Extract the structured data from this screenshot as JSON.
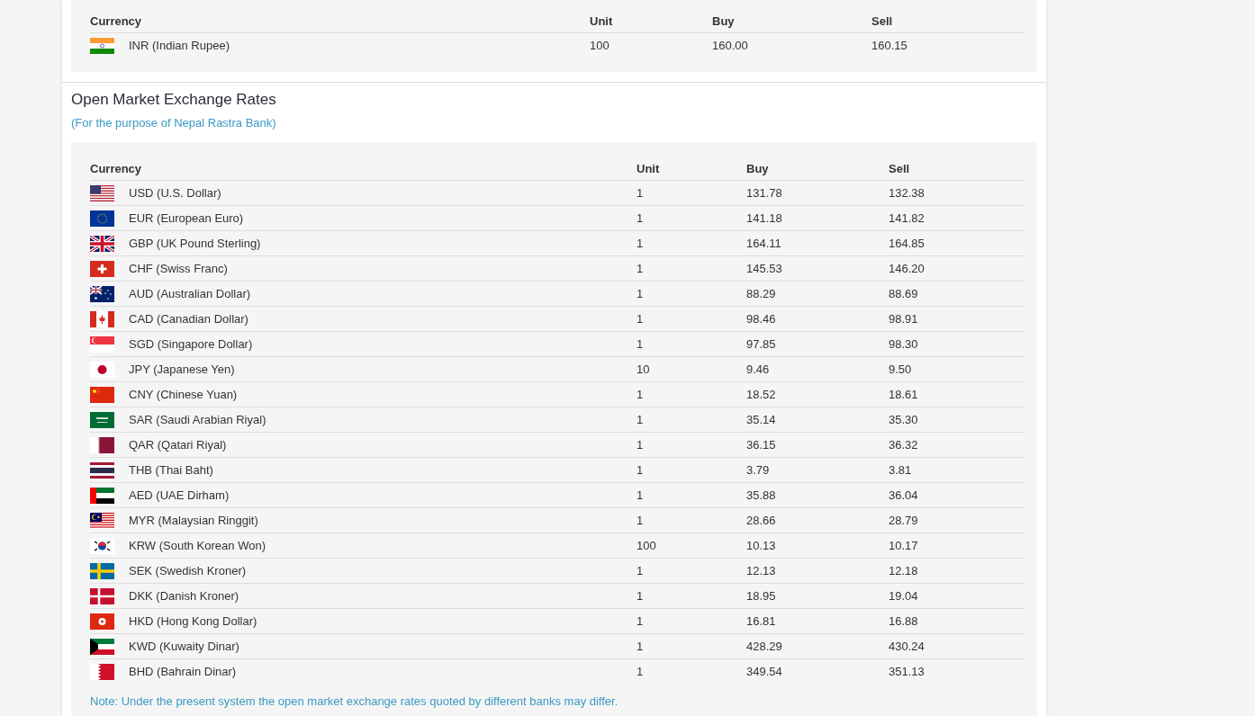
{
  "official_rates": {
    "columns": [
      "Currency",
      "Unit",
      "Buy",
      "Sell"
    ],
    "rows": [
      {
        "kind": "in",
        "currency": "INR (Indian Rupee)",
        "unit": "100",
        "buy": "160.00",
        "sell": "160.15"
      }
    ]
  },
  "open_market": {
    "title": "Open Market Exchange Rates",
    "subtitle": "(For the purpose of Nepal Rastra Bank)",
    "columns": [
      "Currency",
      "Unit",
      "Buy",
      "Sell"
    ],
    "rows": [
      {
        "kind": "us",
        "currency": "USD (U.S. Dollar)",
        "unit": "1",
        "buy": "131.78",
        "sell": "132.38"
      },
      {
        "kind": "eu",
        "currency": "EUR (European Euro)",
        "unit": "1",
        "buy": "141.18",
        "sell": "141.82"
      },
      {
        "kind": "gb",
        "currency": "GBP (UK Pound Sterling)",
        "unit": "1",
        "buy": "164.11",
        "sell": "164.85"
      },
      {
        "kind": "ch",
        "currency": "CHF (Swiss Franc)",
        "unit": "1",
        "buy": "145.53",
        "sell": "146.20"
      },
      {
        "kind": "au",
        "currency": "AUD (Australian Dollar)",
        "unit": "1",
        "buy": "88.29",
        "sell": "88.69"
      },
      {
        "kind": "ca",
        "currency": "CAD (Canadian Dollar)",
        "unit": "1",
        "buy": "98.46",
        "sell": "98.91"
      },
      {
        "kind": "sg",
        "currency": "SGD (Singapore Dollar)",
        "unit": "1",
        "buy": "97.85",
        "sell": "98.30"
      },
      {
        "kind": "jp",
        "currency": "JPY (Japanese Yen)",
        "unit": "10",
        "buy": "9.46",
        "sell": "9.50"
      },
      {
        "kind": "cn",
        "currency": "CNY (Chinese Yuan)",
        "unit": "1",
        "buy": "18.52",
        "sell": "18.61"
      },
      {
        "kind": "sa",
        "currency": "SAR (Saudi Arabian Riyal)",
        "unit": "1",
        "buy": "35.14",
        "sell": "35.30"
      },
      {
        "kind": "qa",
        "currency": "QAR (Qatari Riyal)",
        "unit": "1",
        "buy": "36.15",
        "sell": "36.32"
      },
      {
        "kind": "th",
        "currency": "THB (Thai Baht)",
        "unit": "1",
        "buy": "3.79",
        "sell": "3.81"
      },
      {
        "kind": "ae",
        "currency": "AED (UAE Dirham)",
        "unit": "1",
        "buy": "35.88",
        "sell": "36.04"
      },
      {
        "kind": "my",
        "currency": "MYR (Malaysian Ringgit)",
        "unit": "1",
        "buy": "28.66",
        "sell": "28.79"
      },
      {
        "kind": "kr",
        "currency": "KRW (South Korean Won)",
        "unit": "100",
        "buy": "10.13",
        "sell": "10.17"
      },
      {
        "kind": "se",
        "currency": "SEK (Swedish Kroner)",
        "unit": "1",
        "buy": "12.13",
        "sell": "12.18"
      },
      {
        "kind": "dk",
        "currency": "DKK (Danish Kroner)",
        "unit": "1",
        "buy": "18.95",
        "sell": "19.04"
      },
      {
        "kind": "hk",
        "currency": "HKD (Hong Kong Dollar)",
        "unit": "1",
        "buy": "16.81",
        "sell": "16.88"
      },
      {
        "kind": "kw",
        "currency": "KWD (Kuwaity Dinar)",
        "unit": "1",
        "buy": "428.29",
        "sell": "430.24"
      },
      {
        "kind": "bh",
        "currency": "BHD (Bahrain Dinar)",
        "unit": "1",
        "buy": "349.54",
        "sell": "351.13"
      }
    ],
    "note": "Note: Under the present system the open market exchange rates quoted by different banks may differ."
  }
}
